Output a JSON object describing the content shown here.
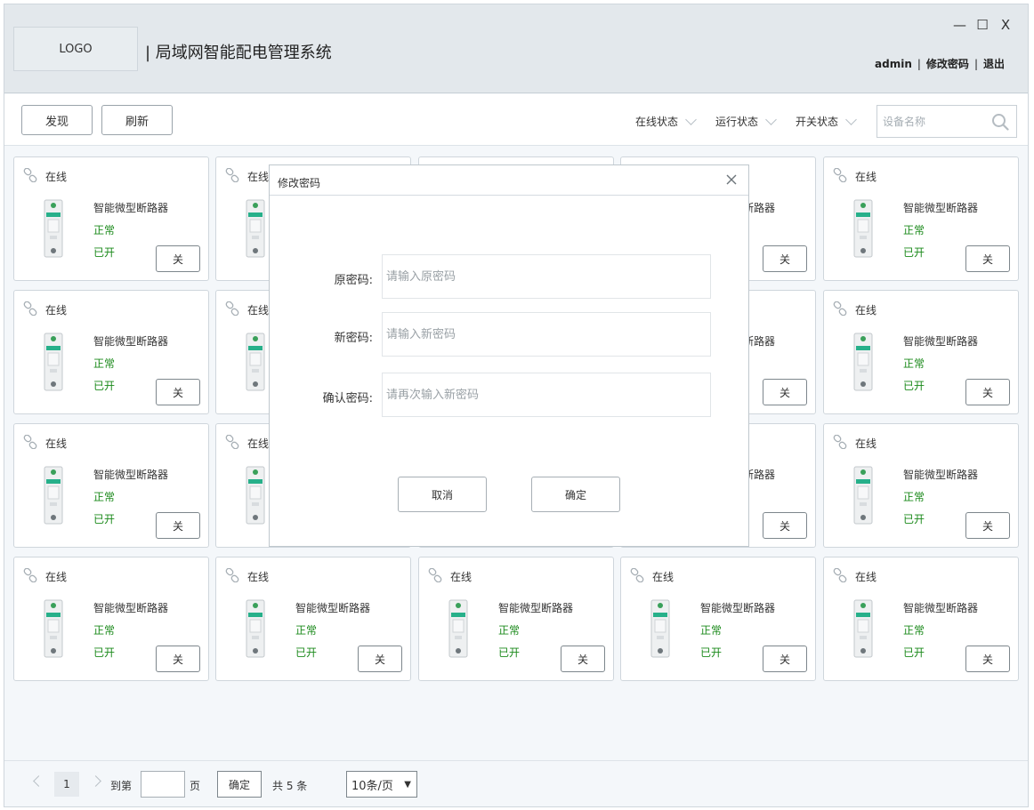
{
  "header": {
    "logo_text": "LOGO",
    "title": "| 局域网智能配电管理系统",
    "window_controls": {
      "minimize": "—",
      "maximize": "☐",
      "close": "X"
    },
    "user": {
      "name": "admin",
      "sep1": "|",
      "change_password": "修改密码",
      "sep2": "|",
      "logout": "退出"
    }
  },
  "toolbar": {
    "discover_label": "发现",
    "refresh_label": "刷新",
    "filters": [
      "在线状态",
      "运行状态",
      "开关状态"
    ],
    "search_placeholder": "设备名称"
  },
  "device_card": {
    "online_label": "在线",
    "name": "智能微型断路器",
    "status": "正常",
    "switch_state": "已开",
    "button_label": "关"
  },
  "device_count": 20,
  "modal": {
    "title": "修改密码",
    "fields": [
      {
        "label": "原密码:",
        "placeholder": "请输入原密码"
      },
      {
        "label": "新密码:",
        "placeholder": "请输入新密码"
      },
      {
        "label": "确认密码:",
        "placeholder": "请再次输入新密码"
      }
    ],
    "cancel_label": "取消",
    "confirm_label": "确定"
  },
  "pagination": {
    "current_page": "1",
    "goto_label": "到第",
    "page_unit": "页",
    "go_label": "确定",
    "total_label": "共 5 条",
    "page_size": "10条/页"
  },
  "colors": {
    "header_bg": "#e3e8ec",
    "status_green": "#1b8a1b",
    "page_bg": "#f4f7fa"
  }
}
